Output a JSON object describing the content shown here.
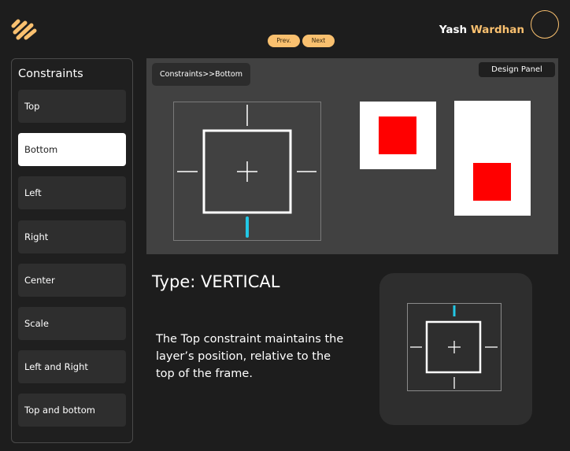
{
  "header": {
    "prev_label": "Prev.",
    "next_label": "Next",
    "user_first": "Yash",
    "user_last": "Wardhan"
  },
  "sidebar": {
    "title": "Constraints",
    "items": [
      {
        "label": "Top"
      },
      {
        "label": "Bottom"
      },
      {
        "label": "Left"
      },
      {
        "label": "Right"
      },
      {
        "label": "Center"
      },
      {
        "label": "Scale"
      },
      {
        "label": "Left and Right"
      },
      {
        "label": "Top and bottom"
      }
    ],
    "active_index": 1
  },
  "canvas": {
    "breadcrumb": "Constraints>>Bottom",
    "design_panel_label": "Design Panel"
  },
  "info": {
    "type_title": "Type: VERTICAL",
    "description": "The Top constraint maintains the layer’s position, relative to the top of the frame."
  },
  "colors": {
    "accent": "#f9c06f",
    "constraint_highlight": "#22c8e6",
    "layer": "#ff0000",
    "active_item_bg": "#ffffff"
  },
  "icons": {
    "logo": "pill-logo-icon",
    "avatar": "avatar-circle"
  }
}
